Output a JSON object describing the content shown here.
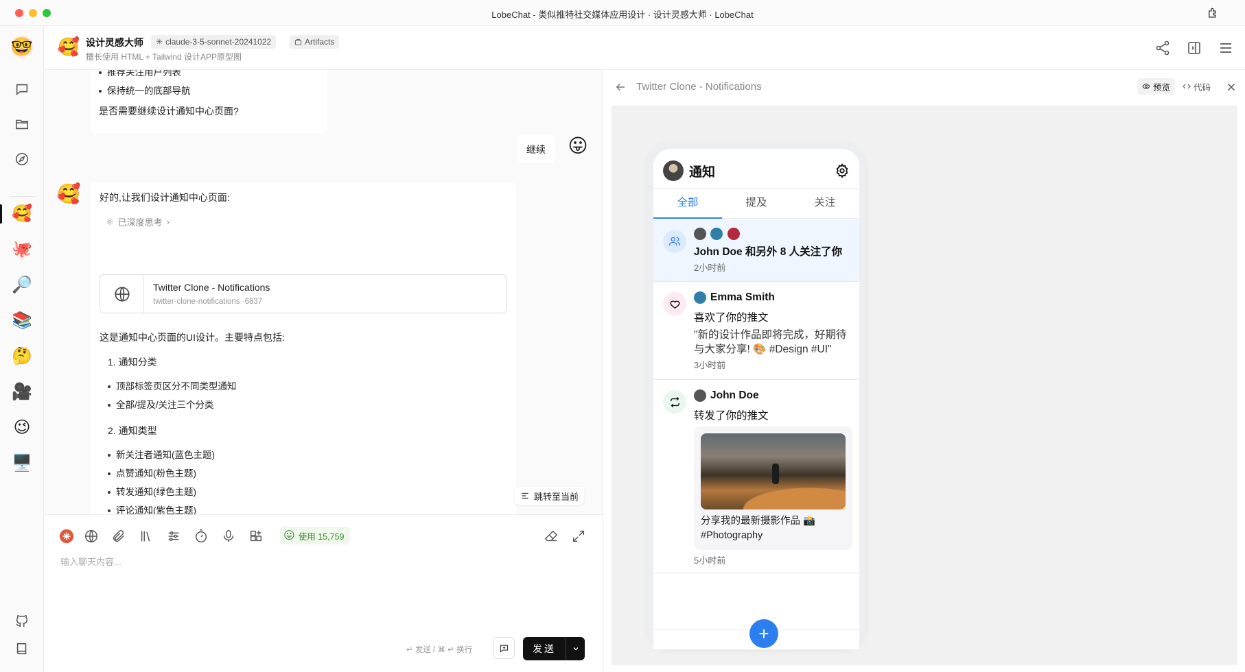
{
  "window": {
    "title": "LobeChat - 类似推特社交媒体应用设计 · 设计灵感大师 · LobeChat"
  },
  "header": {
    "agent_name": "设计灵感大师",
    "agent_desc": "擅长使用 HTML + Tailwind 设计APP原型图",
    "model_tag": "claude-3-5-sonnet-20241022",
    "artifacts_tag": "Artifacts"
  },
  "rail": {
    "agents": [
      "🥰",
      "🐙",
      "🔎",
      "📚",
      "🤔",
      "🎥",
      "😉",
      "🖥️"
    ]
  },
  "chat": {
    "prev_bullets": [
      "推荐关注用户列表",
      "保持统一的底部导航"
    ],
    "prev_question": "是否需要继续设计通知中心页面?",
    "user_message": "继续",
    "reply_intro": "好的,让我们设计通知中心页面:",
    "think_label": "已深度思考",
    "artifact": {
      "title": "Twitter Clone - Notifications",
      "subtitle": "twitter-clone-notifications ·6837"
    },
    "summary": "这是通知中心页面的UI设计。主要特点包括:",
    "section1": "1. 通知分类",
    "section1_bullets": [
      "顶部标签页区分不同类型通知",
      "全部/提及/关注三个分类"
    ],
    "section2": "2. 通知类型",
    "section2_bullets": [
      "新关注者通知(蓝色主题)",
      "点赞通知(粉色主题)",
      "转发通知(绿色主题)",
      "评论通知(紫色主题)"
    ],
    "jump_label": "跳转至当前"
  },
  "input": {
    "usage_label": "使用 15,759",
    "placeholder": "输入聊天内容...",
    "hint": "↵ 发送 / ⌘ ↵ 换行",
    "send_label": "发送"
  },
  "panel": {
    "title": "Twitter Clone - Notifications",
    "preview_label": "预览",
    "code_label": "代码"
  },
  "phone": {
    "title": "通知",
    "tabs": [
      "全部",
      "提及",
      "关注"
    ],
    "notifications": [
      {
        "line": "John Doe 和另外 8 人关注了你",
        "time": "2小时前"
      },
      {
        "name": "Emma Smith",
        "line": "喜欢了你的推文",
        "quote": "\"新的设计作品即将完成，好期待与大家分享! 🎨 #Design #UI\"",
        "time": "3小时前"
      },
      {
        "name": "John Doe",
        "line": "转发了你的推文",
        "caption": "分享我的最新摄影作品 📸 #Photography",
        "time": "5小时前"
      }
    ],
    "fab": "+"
  },
  "colors": {
    "accent": "#2d7ff0",
    "follow_bg": "#eff6ff",
    "like_bg": "#fdeaf3",
    "retweet_bg": "#e8f8ee"
  }
}
